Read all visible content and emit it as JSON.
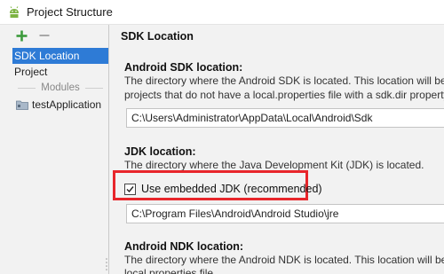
{
  "window": {
    "title": "Project Structure"
  },
  "sidebar": {
    "items": [
      {
        "label": "SDK Location",
        "selected": true
      },
      {
        "label": "Project",
        "selected": false
      }
    ],
    "modules_header": "Modules",
    "modules": [
      {
        "label": "testApplication"
      }
    ]
  },
  "main": {
    "page_title": "SDK Location",
    "android_sdk": {
      "title": "Android SDK location:",
      "desc_line1": "The directory where the Android SDK is located. This location will be u",
      "desc_line2": "projects that do not have a local.properties file with a sdk.dir property",
      "path": "C:\\Users\\Administrator\\AppData\\Local\\Android\\Sdk"
    },
    "jdk": {
      "title": "JDK location:",
      "desc": "The directory where the Java Development Kit (JDK) is located.",
      "checkbox_label": "Use embedded JDK (recommended)",
      "checkbox_checked": true,
      "path": "C:\\Program Files\\Android\\Android Studio\\jre"
    },
    "android_ndk": {
      "title": "Android NDK location:",
      "desc_line1": "The directory where the Android NDK is located. This location will be s",
      "desc_line2": "local.properties file."
    }
  },
  "colors": {
    "selection": "#2e7bd6",
    "highlight": "#e8262b",
    "add_icon": "#3c9a3c"
  },
  "icons": [
    "android-icon",
    "add-icon",
    "remove-icon",
    "folder-icon",
    "checkmark-icon"
  ]
}
